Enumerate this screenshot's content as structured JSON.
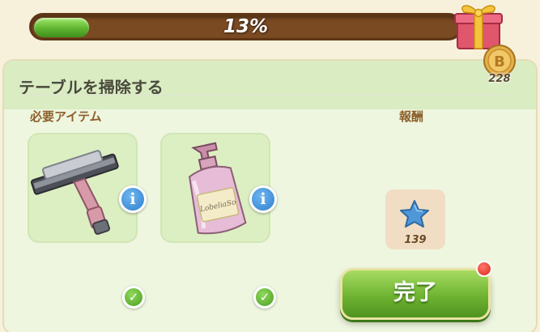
{
  "progress": {
    "percent_label": "13%",
    "fraction": 0.13
  },
  "task": {
    "title": "テーブルを掃除する"
  },
  "currency": {
    "icon": "coin-b-icon",
    "amount": "228"
  },
  "requirements": {
    "label": "必要アイテム",
    "items": [
      {
        "icon": "squeegee-icon",
        "info_icon": "info-icon",
        "status_icon": "checkmark-icon"
      },
      {
        "icon": "soap-bottle-icon",
        "bottle_text": "LobeliaSo",
        "info_icon": "info-icon",
        "status_icon": "checkmark-icon"
      }
    ]
  },
  "reward": {
    "label": "報酬",
    "icon": "blue-star-icon",
    "amount": "139"
  },
  "actions": {
    "complete_label": "完了"
  },
  "colors": {
    "progress_fill": "#5fb52f",
    "progress_track": "#7a4a22",
    "panel": "#eef6df",
    "header": "#d9ecc2",
    "label": "#8b5e2a",
    "button": "#6fb331",
    "info": "#2f7fd0",
    "notify": "#d9261a"
  }
}
